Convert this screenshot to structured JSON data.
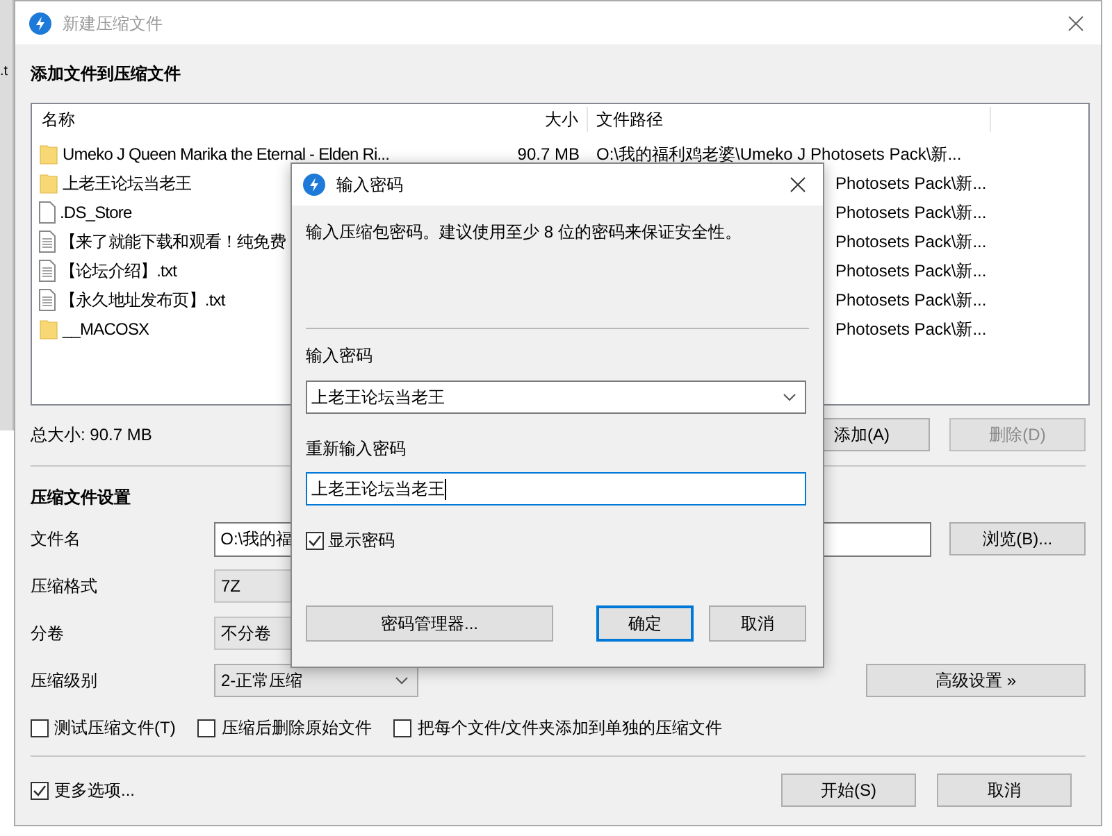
{
  "background_window": {
    "text": ".t"
  },
  "window": {
    "title": "新建压缩文件"
  },
  "files": {
    "heading": "添加文件到压缩文件",
    "columns": [
      "名称",
      "大小",
      "文件路径"
    ],
    "rows": [
      {
        "kind": "folder",
        "name": "Umeko J Queen Marika the Eternal - Elden Ri...",
        "size": "90.7 MB",
        "path": "O:\\我的福利鸡老婆\\Umeko J Photosets Pack\\新..."
      },
      {
        "kind": "folder",
        "name": "上老王论坛当老王",
        "path_tail": "Photosets Pack\\新..."
      },
      {
        "kind": "file",
        "name": ".DS_Store",
        "path_tail": "Photosets Pack\\新..."
      },
      {
        "kind": "text",
        "name": "【来了就能下载和观看！纯免费",
        "path_tail": "Photosets Pack\\新..."
      },
      {
        "kind": "text",
        "name": "【论坛介绍】.txt",
        "path_tail": "Photosets Pack\\新..."
      },
      {
        "kind": "text",
        "name": "【永久地址发布页】.txt",
        "path_tail": "Photosets Pack\\新..."
      },
      {
        "kind": "folder",
        "name": "__MACOSX",
        "path_tail": "Photosets Pack\\新..."
      }
    ]
  },
  "total_size": "总大小: 90.7 MB",
  "list_buttons": [
    {
      "label": "添加(A)",
      "disabled": false
    },
    {
      "label": "删除(D)",
      "disabled": true
    }
  ],
  "settings": {
    "heading": "压缩文件设置",
    "filename": {
      "label": "文件名",
      "value": "O:\\我的福"
    },
    "browse_button": "浏览(B)...",
    "format": {
      "label": "压缩格式",
      "value": "7Z"
    },
    "split": {
      "label": "分卷",
      "value": "不分卷"
    },
    "level": {
      "label": "压缩级别",
      "value": "2-正常压缩"
    },
    "advanced_button": "高级设置 »",
    "options": [
      {
        "label": "测试压缩文件(T)",
        "checked": false
      },
      {
        "label": "压缩后删除原始文件",
        "checked": false
      },
      {
        "label": "把每个文件/文件夹添加到单独的压缩文件",
        "checked": false
      }
    ]
  },
  "more_options": {
    "label": "更多选项...",
    "checked": true
  },
  "footer_buttons": [
    "开始(S)",
    "取消"
  ],
  "password_dialog": {
    "title": "输入密码",
    "hint": "输入压缩包密码。建议使用至少 8 位的密码来保证安全性。",
    "password": {
      "label": "输入密码",
      "value": "上老王论坛当老王"
    },
    "confirm": {
      "label": "重新输入密码",
      "value": "上老王论坛当老王"
    },
    "show_password": {
      "label": "显示密码",
      "checked": true
    },
    "manager_button": "密码管理器...",
    "buttons": [
      {
        "label": "确定",
        "focused": true
      },
      {
        "label": "取消",
        "focused": false
      }
    ]
  }
}
